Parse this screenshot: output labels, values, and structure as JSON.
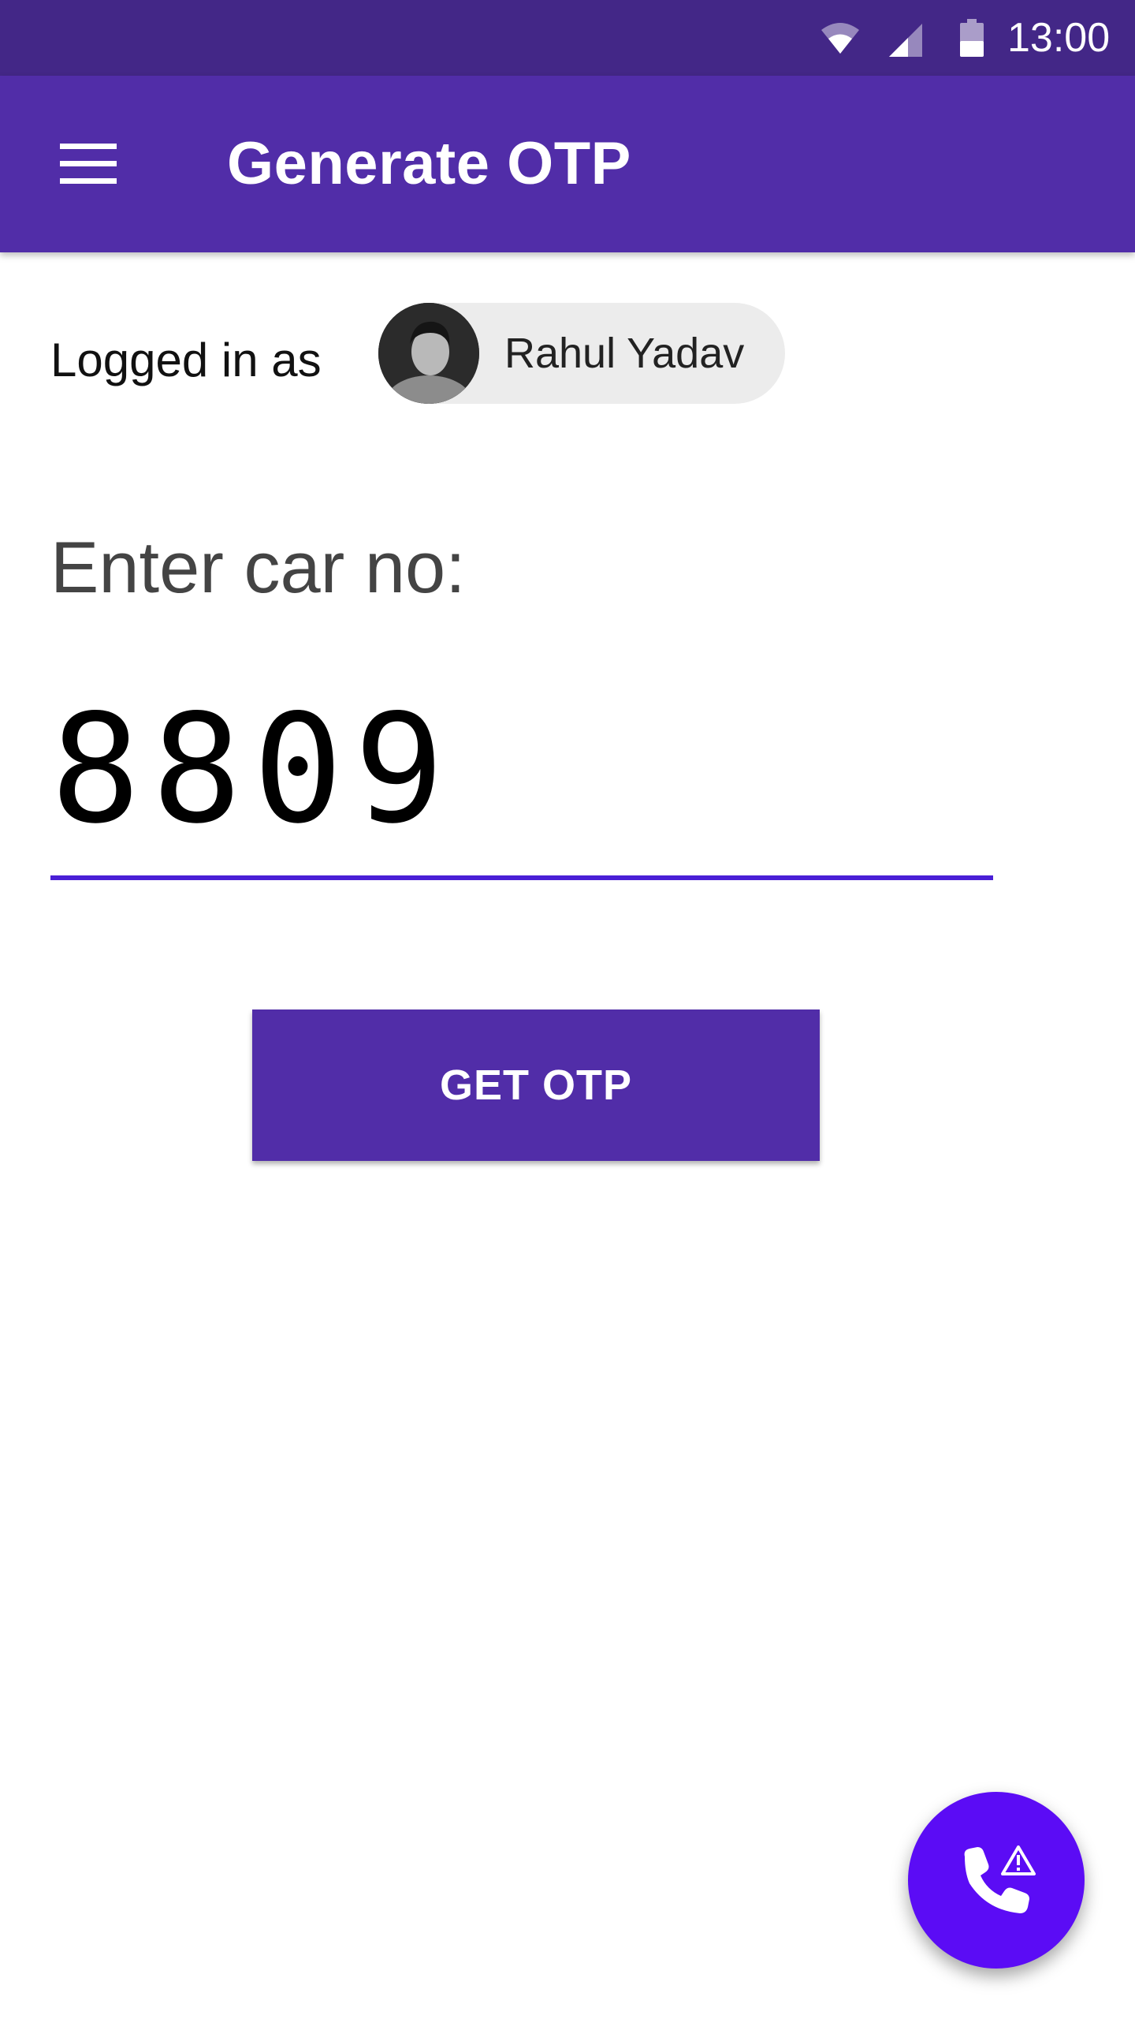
{
  "status_bar": {
    "time": "13:00",
    "icons": [
      "wifi-icon",
      "signal-icon",
      "battery-icon"
    ]
  },
  "app_bar": {
    "title": "Generate OTP",
    "menu_icon": "hamburger-menu-icon"
  },
  "user": {
    "logged_in_label": "Logged in as",
    "name": "Rahul Yadav"
  },
  "form": {
    "car_label": "Enter car no:",
    "car_number_value": "8809",
    "submit_label": "GET OTP"
  },
  "fab": {
    "icon": "phone-alert-icon"
  },
  "colors": {
    "status_bar": "#432787",
    "primary": "#512da8",
    "accent": "#5b0cf5",
    "input_underline": "#4a1fd6"
  }
}
